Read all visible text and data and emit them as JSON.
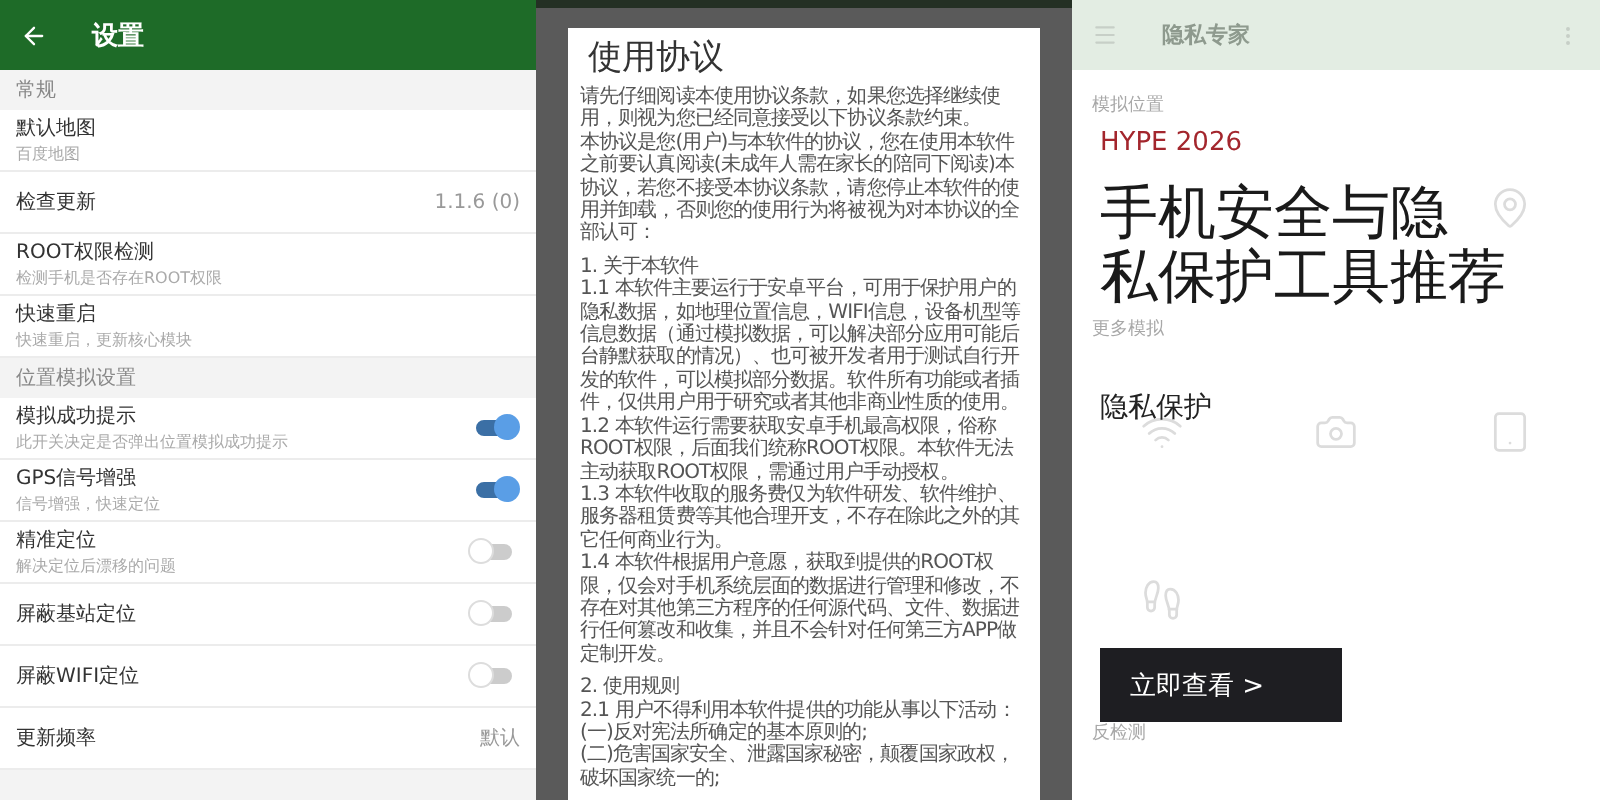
{
  "settings_screen": {
    "title": "设置",
    "sections": [
      {
        "header": "常规",
        "items": [
          {
            "kind": "plain",
            "title": "默认地图",
            "subtitle": "百度地图"
          },
          {
            "kind": "value",
            "title": "检查更新",
            "value": "1.1.6 (0)"
          },
          {
            "kind": "plain",
            "title": "ROOT权限检测",
            "subtitle": "检测手机是否存在ROOT权限"
          },
          {
            "kind": "plain",
            "title": "快速重启",
            "subtitle": "快速重启，更新核心模块"
          }
        ]
      },
      {
        "header": "位置模拟设置",
        "items": [
          {
            "kind": "toggle",
            "title": "模拟成功提示",
            "subtitle": "此开关决定是否弹出位置模拟成功提示",
            "on": true
          },
          {
            "kind": "toggle",
            "title": "GPS信号增强",
            "subtitle": "信号增强，快速定位",
            "on": true
          },
          {
            "kind": "toggle",
            "title": "精准定位",
            "subtitle": "解决定位后漂移的问题",
            "on": false
          },
          {
            "kind": "toggle",
            "title": "屏蔽基站定位",
            "on": false
          },
          {
            "kind": "toggle",
            "title": "屏蔽WIFI定位",
            "on": false
          },
          {
            "kind": "value",
            "title": "更新频率",
            "value": "默认"
          }
        ]
      }
    ]
  },
  "agreement_dialog": {
    "title": "使用协议",
    "paragraphs": [
      "请先仔细阅读本使用协议条款，如果您选择继续使用，则视为您已经同意接受以下协议条款约束。",
      "本协议是您(用户)与本软件的协议，您在使用本软件之前要认真阅读(未成年人需在家长的陪同下阅读)本协议，若您不接受本协议条款，请您停止本软件的使用并卸载，否则您的使用行为将被视为对本协议的全部认可：",
      "1. 关于本软件",
      "1.1 本软件主要运行于安卓平台，可用于保护用户的隐私数据，如地理位置信息，WIFI信息，设备机型等信息数据（通过模拟数据，可以解决部分应用可能后台静默获取的情况）、也可被开发者用于测试自行开发的软件，可以模拟部分数据。软件所有功能或者插件，仅供用户用于研究或者其他非商业性质的使用。",
      "1.2 本软件运行需要获取安卓手机最高权限，俗称ROOT权限，后面我们统称ROOT权限。本软件无法主动获取ROOT权限，需通过用户手动授权。",
      "1.3 本软件收取的服务费仅为软件研发、软件维护、服务器租赁费等其他合理开支，不存在除此之外的其它任何商业行为。",
      "1.4 本软件根据用户意愿，获取到提供的ROOT权限，仅会对手机系统层面的数据进行管理和修改，不存在对其他第三方程序的任何源代码、文件、数据进行任何篡改和收集，并且不会针对任何第三方APP做定制开发。",
      "2. 使用规则",
      "2.1 用户不得利用本软件提供的功能从事以下活动：",
      " (一)反对宪法所确定的基本原则的;",
      " (二)危害国家安全、泄露国家秘密，颠覆国家政权，破坏国家统一的;"
    ]
  },
  "privacy_screen": {
    "title": "隐私专家",
    "sections": [
      {
        "header": "模拟位置"
      },
      {
        "header": "更多模拟"
      },
      {
        "header": "反检测"
      }
    ]
  },
  "promo": {
    "eyebrow": "HYPE 2026",
    "headline_lines": [
      "手机安全与隐",
      "私保护工具推荐"
    ],
    "tag": "隐私保护",
    "cta": "立即查看 >"
  }
}
